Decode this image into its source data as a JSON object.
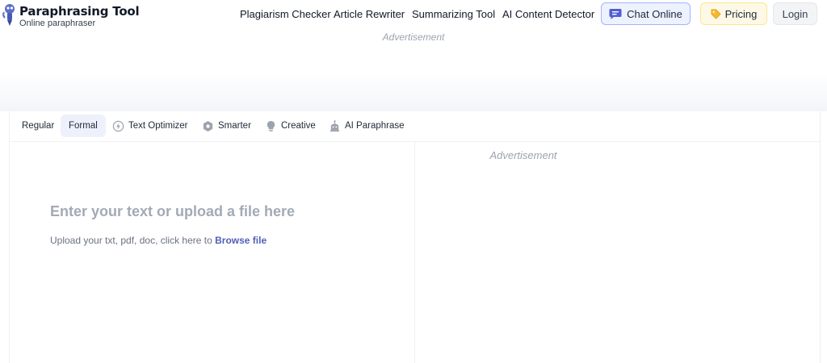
{
  "brand": {
    "title": "Paraphrasing Tool",
    "subtitle": "Online paraphraser",
    "accent": "#4f5fb8"
  },
  "nav": {
    "links": [
      "Plagiarism Checker",
      "Article Rewriter",
      "Summarizing Tool",
      "AI Content Detector"
    ],
    "chat_label": "Chat Online",
    "pricing_label": "Pricing",
    "login_label": "Login"
  },
  "ads": {
    "top": "Advertisement",
    "right": "Advertisement"
  },
  "tabs": [
    {
      "label": "Regular",
      "icon": null,
      "active": false
    },
    {
      "label": "Formal",
      "icon": null,
      "active": true
    },
    {
      "label": "Text Optimizer",
      "icon": "lightning-icon",
      "active": false
    },
    {
      "label": "Smarter",
      "icon": "hexagon-icon",
      "active": false
    },
    {
      "label": "Creative",
      "icon": "bulb-icon",
      "active": false
    },
    {
      "label": "AI Paraphrase",
      "icon": "robot-icon",
      "active": false
    }
  ],
  "editor": {
    "placeholder": "Enter your text or upload a file here",
    "upload_hint": "Upload your txt, pdf, doc, click here to",
    "upload_link": "Browse file"
  }
}
